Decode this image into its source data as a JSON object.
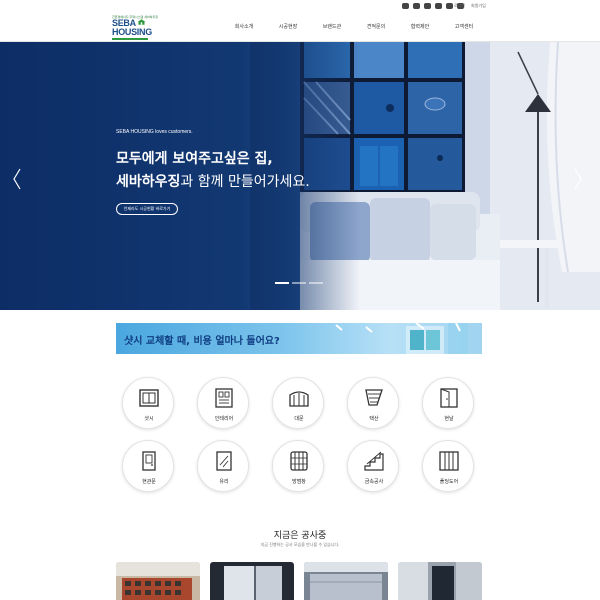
{
  "topbar": {
    "social_icons": [
      "youtube-icon",
      "blog-icon",
      "instagram-icon",
      "talk-icon",
      "kakao-icon",
      "naver-icon"
    ],
    "links": [
      "로그인",
      "회원가입"
    ]
  },
  "header": {
    "logo": {
      "tagline": "친환경에너지 주택시스템  세바하우징",
      "line1": "SEBA",
      "line2": "HOUSING"
    },
    "nav": [
      "회사소개",
      "시공현장",
      "브랜드관",
      "견적문의",
      "협력제안",
      "고객센터"
    ]
  },
  "hero": {
    "small": "SEBA HOUSING loves customers.",
    "line1": "모두에게 보여주고싶은 집,",
    "line2_bold": "세바하우징",
    "line2_rest": "과 함께 만들어가세요.",
    "button": "언제라도 시공현황 바로가기",
    "slide_dots": 3,
    "active_dot": 0
  },
  "banner": {
    "text": "샷시 교체할 때, 비용 얼마나 들어요?"
  },
  "categories": [
    {
      "label": "샷시",
      "icon": "window-frame-icon"
    },
    {
      "label": "인테리어",
      "icon": "interior-icon"
    },
    {
      "label": "대문",
      "icon": "gate-icon"
    },
    {
      "label": "택산",
      "icon": "blind-icon"
    },
    {
      "label": "현날",
      "icon": "door-open-icon"
    },
    {
      "label": "현관문",
      "icon": "front-door-icon"
    },
    {
      "label": "유리",
      "icon": "glass-icon"
    },
    {
      "label": "방범창",
      "icon": "security-window-icon"
    },
    {
      "label": "금속공사",
      "icon": "metal-stairs-icon"
    },
    {
      "label": "폴딩도어",
      "icon": "folding-door-icon"
    }
  ],
  "construction": {
    "title": "지금은 공사중",
    "subtitle": "지금 진행하는 공사 모습을 만나볼 수 있습니다."
  },
  "colors": {
    "brand_navy": "#0d2d66",
    "brand_green": "#2f9a3e",
    "banner_text": "#0f3d82"
  }
}
